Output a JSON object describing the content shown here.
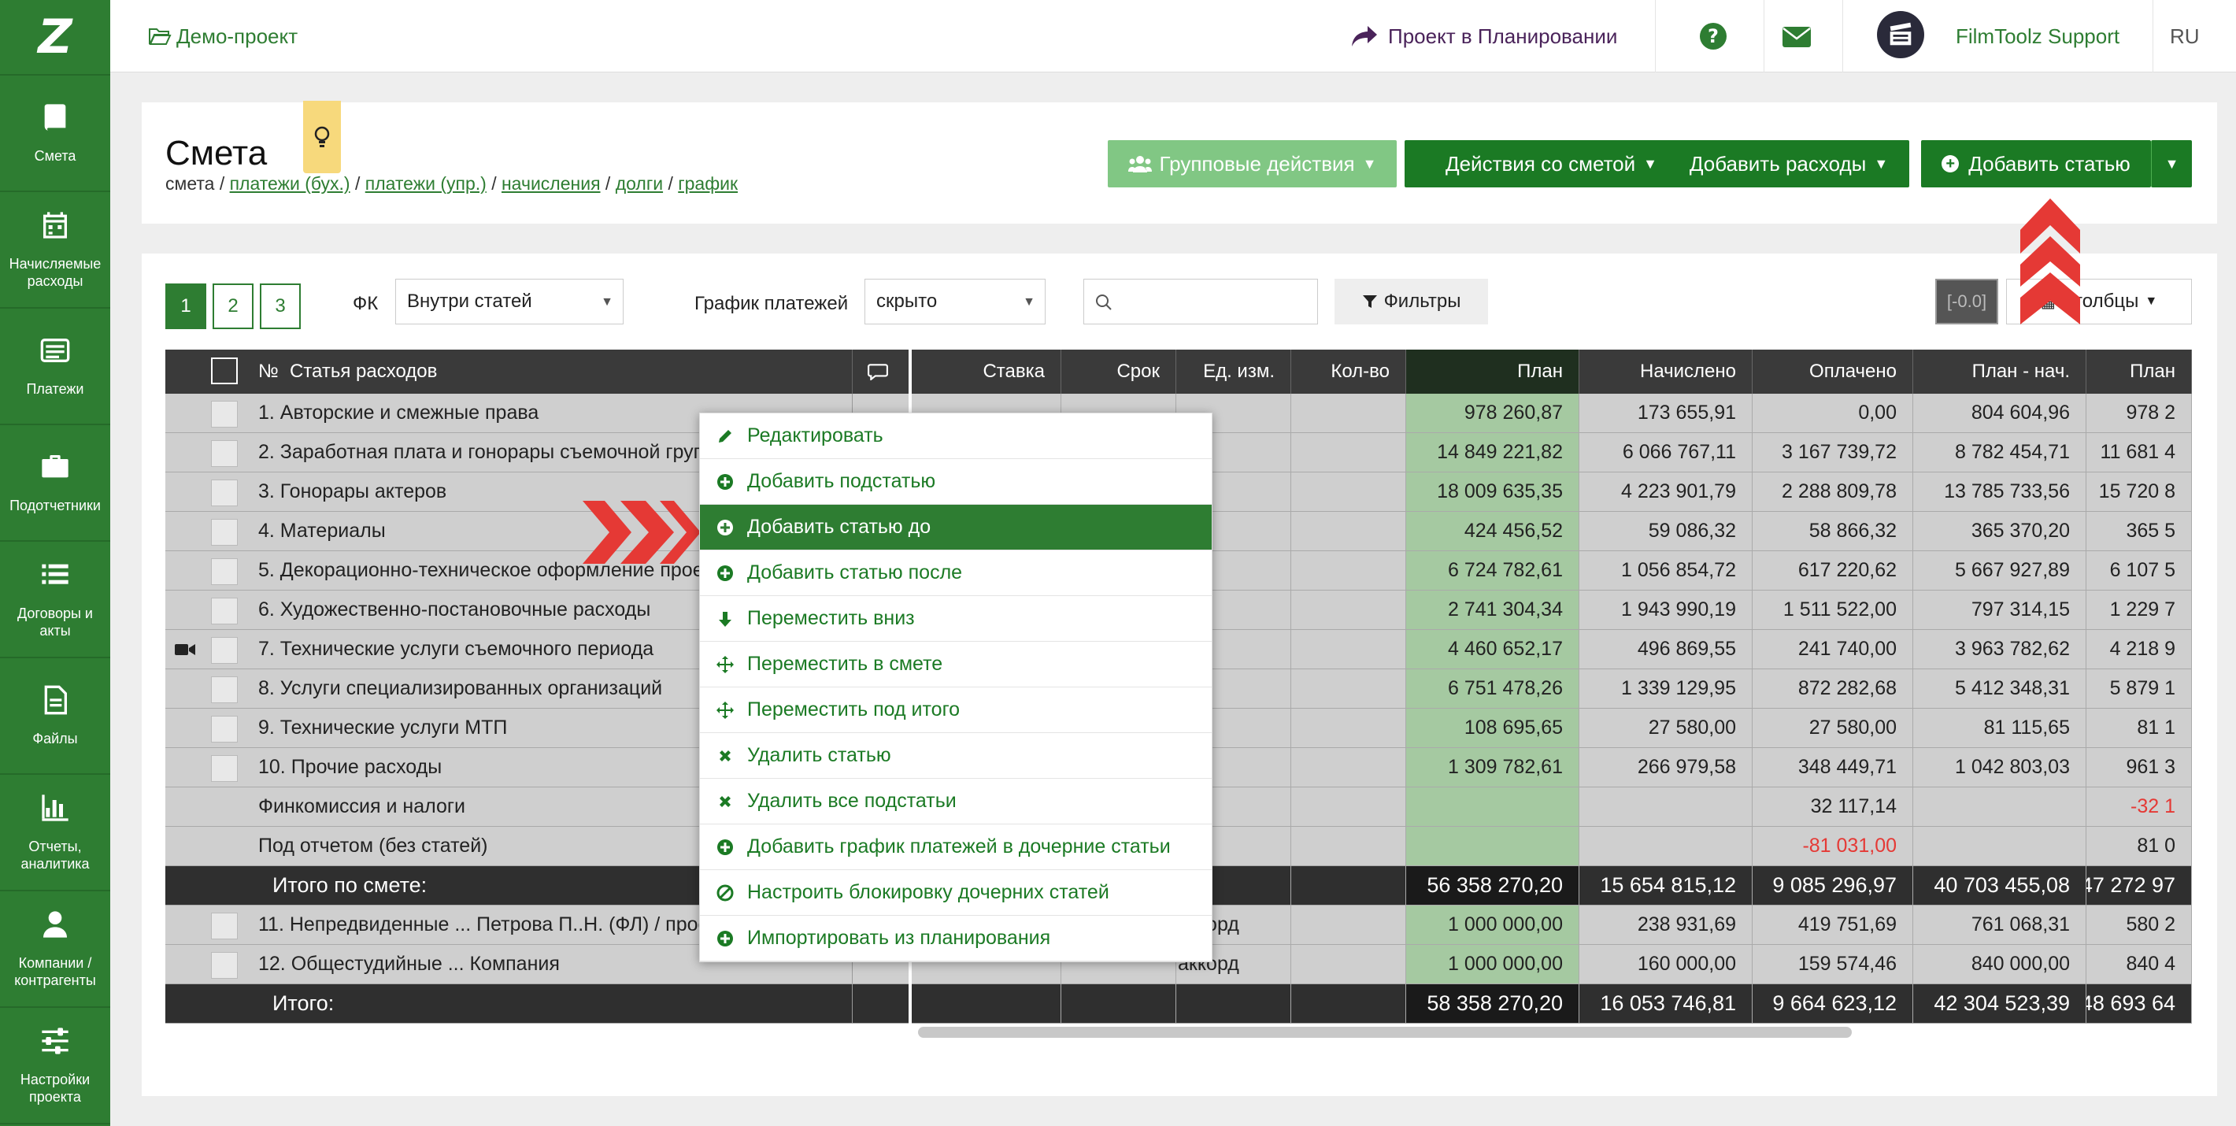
{
  "sidebar": {
    "logo": "Z",
    "items": [
      {
        "label": "Смета"
      },
      {
        "label": "Начисляемые расходы"
      },
      {
        "label": "Платежи"
      },
      {
        "label": "Подотчетники"
      },
      {
        "label": "Договоры и акты"
      },
      {
        "label": "Файлы"
      },
      {
        "label": "Отчеты, аналитика"
      },
      {
        "label": "Компании / контрагенты"
      },
      {
        "label": "Настройки проекта"
      }
    ]
  },
  "topbar": {
    "project": "Демо-проект",
    "plan_link": "Проект в Планировании",
    "user": "FilmToolz Support",
    "lang": "RU"
  },
  "header": {
    "title": "Смета",
    "breadcrumb": {
      "current": "смета",
      "links": [
        "платежи (бух.)",
        "платежи (упр.)",
        "начисления",
        "долги",
        "график"
      ],
      "sep": "/"
    },
    "buttons": {
      "group": "Групповые действия",
      "actions": "Действия со сметой",
      "add_expenses": "Добавить расходы",
      "add_article": "Добавить статью"
    }
  },
  "filters": {
    "pages": [
      "1",
      "2",
      "3"
    ],
    "fk_label": "ФК",
    "fk_value": "Внутри статей",
    "schedule_label": "График платежей",
    "schedule_value": "скрыто",
    "search_placeholder": "",
    "filters_btn": "Фильтры",
    "zero_btn": "[-0.0]",
    "columns_btn": "Столбцы"
  },
  "table": {
    "left_headers": {
      "num": "№",
      "name": "Статья расходов"
    },
    "right_headers": [
      "Ставка",
      "Срок",
      "Ед. изм.",
      "Кол-во",
      "План",
      "Начислено",
      "Оплачено",
      "План - нач.",
      "План"
    ],
    "rows": [
      {
        "name": "1. Авторские и смежные права",
        "ed": "",
        "plan": "978 260,87",
        "nach": "173 655,91",
        "opl": "0,00",
        "pn": "804 604,96",
        "plan2": "978 2"
      },
      {
        "name": "2. Заработная плата и гонорары съемочной группы",
        "ed": "",
        "plan": "14 849 221,82",
        "nach": "6 066 767,11",
        "opl": "3 167 739,72",
        "pn": "8 782 454,71",
        "plan2": "11 681 4"
      },
      {
        "name": "3. Гонорары актеров",
        "ed": "",
        "plan": "18 009 635,35",
        "nach": "4 223 901,79",
        "opl": "2 288 809,78",
        "pn": "13 785 733,56",
        "plan2": "15 720 8"
      },
      {
        "name": "4. Материалы",
        "ed": "",
        "plan": "424 456,52",
        "nach": "59 086,32",
        "opl": "58 866,32",
        "pn": "365 370,20",
        "plan2": "365 5"
      },
      {
        "name": "5. Декорационно-техническое оформление проекта",
        "ed": "",
        "plan": "6 724 782,61",
        "nach": "1 056 854,72",
        "opl": "617 220,62",
        "pn": "5 667 927,89",
        "plan2": "6 107 5"
      },
      {
        "name": "6. Художественно-постановочные расходы",
        "ed": "",
        "plan": "2 741 304,34",
        "nach": "1 943 990,19",
        "opl": "1 511 522,00",
        "pn": "797 314,15",
        "plan2": "1 229 7"
      },
      {
        "name": "7. Технические услуги съемочного периода",
        "ed": "",
        "camera": true,
        "plan": "4 460 652,17",
        "nach": "496 869,55",
        "opl": "241 740,00",
        "pn": "3 963 782,62",
        "plan2": "4 218 9"
      },
      {
        "name": "8. Услуги специализированных организаций",
        "ed": "",
        "plan": "6 751 478,26",
        "nach": "1 339 129,95",
        "opl": "872 282,68",
        "pn": "5 412 348,31",
        "plan2": "5 879 1"
      },
      {
        "name": "9. Технические услуги МТП",
        "ed": "",
        "plan": "108 695,65",
        "nach": "27 580,00",
        "opl": "27 580,00",
        "pn": "81 115,65",
        "plan2": "81 1"
      },
      {
        "name": "10. Прочие расходы",
        "ed": "",
        "plan": "1 309 782,61",
        "nach": "266 979,58",
        "opl": "348 449,71",
        "pn": "1 042 803,03",
        "plan2": "961 3"
      },
      {
        "name": "Финкомиссия и налоги",
        "nocheck": true,
        "ed": "",
        "plan": "",
        "nach": "",
        "opl": "32 117,14",
        "pn": "",
        "plan2": "-32 1",
        "plan2_red": true
      },
      {
        "name": "Под отчетом (без статей)",
        "nocheck": true,
        "ed": "",
        "plan": "",
        "nach": "",
        "opl": "-81 031,00",
        "opl_red": true,
        "pn": "",
        "plan2": "81 0"
      },
      {
        "name": "Итого по смете:",
        "total": true,
        "ed": "",
        "plan": "56 358 270,20",
        "nach": "15 654 815,12",
        "opl": "9 085 296,97",
        "pn": "40 703 455,08",
        "plan2": "47 272 97"
      },
      {
        "name": "11. Непредвиденные ... Петрова П..Н. (ФЛ) / проект",
        "ed": "аккорд",
        "plan": "1 000 000,00",
        "nach": "238 931,69",
        "opl": "419 751,69",
        "pn": "761 068,31",
        "plan2": "580 2"
      },
      {
        "name": "12. Общестудийные ... Компания",
        "ed": "аккорд",
        "plan": "1 000 000,00",
        "nach": "160 000,00",
        "opl": "159 574,46",
        "pn": "840 000,00",
        "plan2": "840 4"
      },
      {
        "name": "Итого:",
        "total": true,
        "ed": "",
        "plan": "58 358 270,20",
        "nach": "16 053 746,81",
        "opl": "9 664 623,12",
        "pn": "42 304 523,39",
        "plan2": "48 693 64"
      }
    ]
  },
  "context_menu": {
    "items": [
      {
        "label": "Редактировать",
        "icon": "pencil-icon"
      },
      {
        "label": "Добавить подстатью",
        "icon": "plus-circle-icon"
      },
      {
        "label": "Добавить статью до",
        "icon": "plus-circle-icon",
        "active": true
      },
      {
        "label": "Добавить статью после",
        "icon": "plus-circle-icon"
      },
      {
        "label": "Переместить вниз",
        "icon": "arrow-down-icon"
      },
      {
        "label": "Переместить в смете",
        "icon": "move-icon"
      },
      {
        "label": "Переместить под итого",
        "icon": "move-icon"
      },
      {
        "label": "Удалить статью",
        "icon": "x-icon"
      },
      {
        "label": "Удалить все подстатьи",
        "icon": "x-icon"
      },
      {
        "label": "Добавить график платежей в дочерние статьи",
        "icon": "plus-circle-icon"
      },
      {
        "label": "Настроить блокировку дочерних статей",
        "icon": "ban-icon"
      },
      {
        "label": "Импортировать из планирования",
        "icon": "plus-circle-icon"
      }
    ]
  },
  "colors": {
    "brand": "#2e7d32",
    "plan_column": "#a5c9a1",
    "negative": "#e53935"
  }
}
